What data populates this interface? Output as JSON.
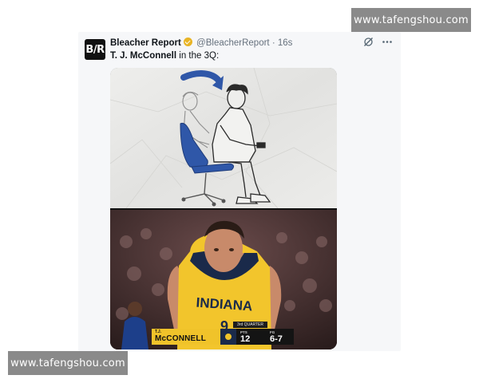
{
  "watermarks": {
    "top": "www.tafengshou.com",
    "bottom": "www.tafengshou.com"
  },
  "tweet": {
    "logo_text": "B/R",
    "author_name": "Bleacher Report",
    "handle": "@BleacherReport",
    "separator": "·",
    "time": "16s",
    "text_bold": "T. J. McConnell",
    "text_rest": " in the 3Q:"
  },
  "scorebug": {
    "player_first": "T.J.",
    "player_last": "McCONNELL",
    "quarter": "3rd QUARTER",
    "pts_label": "PTS",
    "pts_value": "12",
    "fg_label": "FG",
    "fg_value": "6-7"
  },
  "jersey": {
    "text": "INDIANA",
    "number": "9"
  },
  "icons": [
    "verified-badge-icon",
    "grok-icon",
    "more-options-icon",
    "curved-arrow-icon",
    "team-logo-icon"
  ],
  "colors": {
    "verified": "#e8b425",
    "pacers_gold": "#f0c32a",
    "chair_blue": "#2f57a8"
  }
}
